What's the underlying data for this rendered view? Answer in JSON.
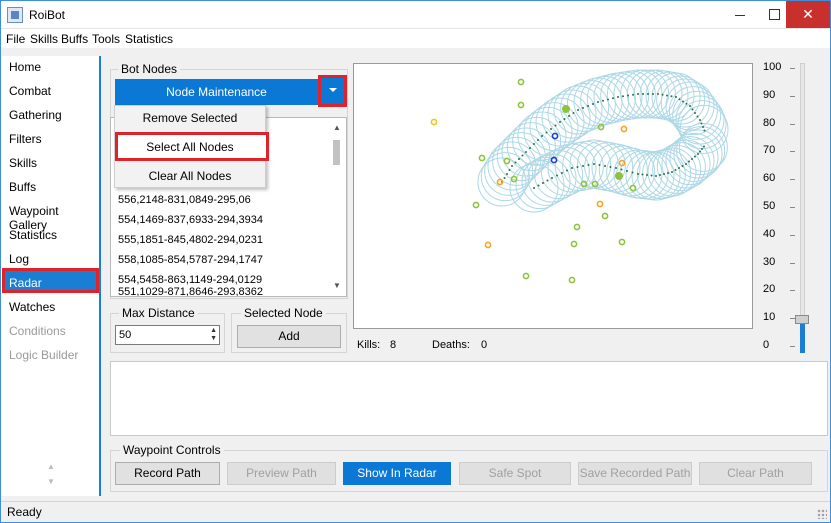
{
  "window": {
    "title": "RoiBot"
  },
  "menu": [
    "File",
    "Skills",
    "Buffs",
    "Tools",
    "Statistics"
  ],
  "sidebar": {
    "items": [
      {
        "label": "Home"
      },
      {
        "label": "Combat"
      },
      {
        "label": "Gathering"
      },
      {
        "label": "Filters"
      },
      {
        "label": "Skills"
      },
      {
        "label": "Buffs"
      },
      {
        "label": "Waypoint Gallery"
      },
      {
        "label": "Statistics"
      },
      {
        "label": "Log"
      },
      {
        "label": "Radar",
        "selected": true
      },
      {
        "label": "Watches"
      },
      {
        "label": "Conditions",
        "disabled": true
      },
      {
        "label": "Logic Builder",
        "disabled": true
      }
    ]
  },
  "bot_nodes": {
    "legend": "Bot Nodes",
    "dropdown_label": "Node Maintenance",
    "menu_items": [
      "Remove Selected",
      "Select All Nodes",
      "Clear All Nodes"
    ],
    "list": [
      "556,2148-831,0849-295,06",
      "554,1469-837,6933-294,3934",
      "555,1851-845,4802-294,0231",
      "558,1085-854,5787-294,1747",
      "554,5458-863,1149-294,0129",
      "551,1029-871,8646-293,8362"
    ]
  },
  "max_distance": {
    "legend": "Max Distance",
    "value": "50"
  },
  "selected_node": {
    "legend": "Selected Node",
    "add_label": "Add"
  },
  "stats": {
    "kills_label": "Kills:",
    "kills": "8",
    "deaths_label": "Deaths:",
    "deaths": "0"
  },
  "zoom_slider": {
    "tick_labels": [
      "100",
      "90",
      "80",
      "70",
      "60",
      "50",
      "40",
      "30",
      "20",
      "10",
      "0"
    ],
    "value": 10
  },
  "waypoint_controls": {
    "legend": "Waypoint Controls",
    "buttons": [
      {
        "label": "Record Path",
        "state": "normal"
      },
      {
        "label": "Preview Path",
        "state": "disabled"
      },
      {
        "label": "Show In Radar",
        "state": "active"
      },
      {
        "label": "Safe Spot",
        "state": "disabled"
      },
      {
        "label": "Save Recorded Path",
        "state": "disabled"
      },
      {
        "label": "Clear Path",
        "state": "disabled"
      }
    ]
  },
  "status": {
    "text": "Ready"
  },
  "colors": {
    "accent": "#0a78d4",
    "highlight_border": "#e0232a",
    "radar_circle": "#add8e6",
    "path_dark": "#2e6e4a",
    "mob_green": "#8dc43c",
    "mob_orange": "#f4a428",
    "mob_yellow": "#e8c81c",
    "mob_blue": "#1e3fc8"
  }
}
